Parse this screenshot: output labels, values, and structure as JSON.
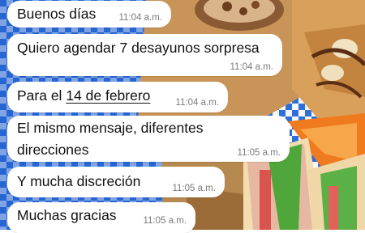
{
  "chat": {
    "messages": [
      {
        "text": "Buenos días",
        "time": "11:04 a.m."
      },
      {
        "text": "Quiero agendar 7 desayunos sorpresa",
        "time": "11:04 a.m."
      },
      {
        "text_prefix": "Para el ",
        "text_link": "14 de febrero",
        "time": "11:04 a.m."
      },
      {
        "text": "El mismo mensaje, diferentes direcciones",
        "time": "11:05 a.m."
      },
      {
        "text": "Y mucha discreción",
        "time": "11:05 a.m."
      },
      {
        "text": "Muchas gracias",
        "time": "11:05 a.m."
      }
    ]
  }
}
